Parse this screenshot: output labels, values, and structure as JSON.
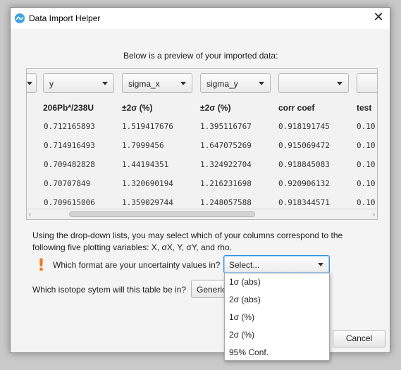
{
  "window": {
    "title": "Data Import Helper",
    "close_glyph": "✕"
  },
  "preview": {
    "label": "Below is a preview of your imported data:",
    "columns": [
      {
        "select_value": "",
        "header": ""
      },
      {
        "select_value": "y",
        "header": "206Pb*/238U"
      },
      {
        "select_value": "sigma_x",
        "header": "±2σ (%)"
      },
      {
        "select_value": "sigma_y",
        "header": "±2σ (%)"
      },
      {
        "select_value": "",
        "header": "corr coef"
      },
      {
        "select_value": "",
        "header": "test"
      }
    ],
    "rows": [
      [
        "0.712165893",
        "1.519417676",
        "1.395116767",
        "0.918191745",
        "0.10"
      ],
      [
        "0.714916493",
        "1.7999456",
        "1.647075269",
        "0.915069472",
        "0.10"
      ],
      [
        "0.709482828",
        "1.44194351",
        "1.324922704",
        "0.918845083",
        "0.10"
      ],
      [
        "0.70707849",
        "1.320690194",
        "1.216231698",
        "0.920906132",
        "0.10"
      ],
      [
        "0.709615006",
        "1.359029744",
        "1.248057588",
        "0.918344571",
        "0.10"
      ]
    ],
    "scroll_left": "‹",
    "scroll_right": "›"
  },
  "instructions": {
    "text": "Using the drop-down lists, you may select which of your columns correspond to the following five plotting variables: X, σX, Y, σY, and rho."
  },
  "format": {
    "warning_glyph": "!",
    "question": "Which format are your uncertainty values in?",
    "select_value": "Select...",
    "options": [
      "1σ (abs)",
      "2σ (abs)",
      "1σ (%)",
      "2σ (%)",
      "95% Conf."
    ]
  },
  "isotope": {
    "question": "Which isotope sytem will this table be in?",
    "button_label": "Generic"
  },
  "footer": {
    "cancel_label": "Cancel"
  },
  "colors": {
    "accent": "#2f8fe3",
    "warning": "#f07a1a",
    "app_icon": "#3aa3e3"
  }
}
